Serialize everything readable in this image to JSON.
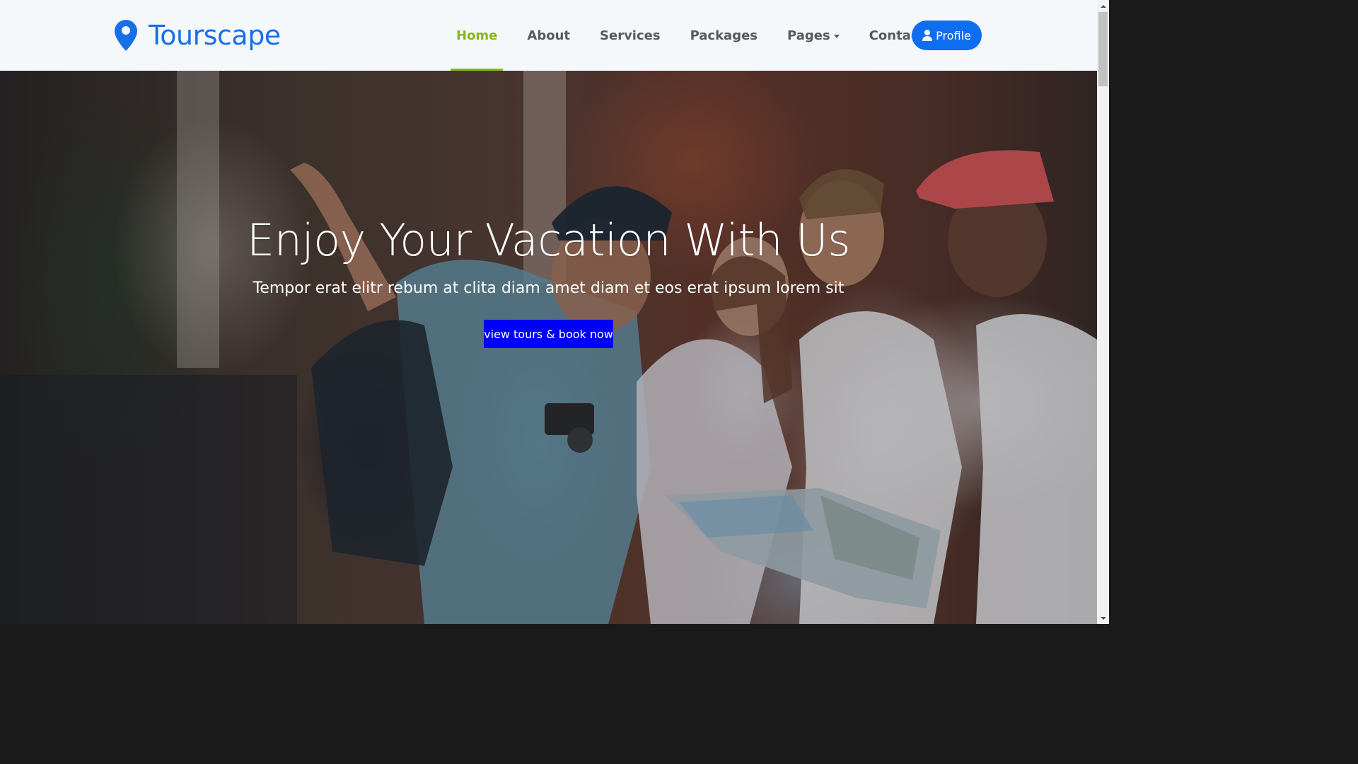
{
  "brand": {
    "name": "Tourscape",
    "icon": "map-marker-icon",
    "color": "#1870e8"
  },
  "nav": {
    "items": [
      {
        "label": "Home",
        "active": true
      },
      {
        "label": "About"
      },
      {
        "label": "Services"
      },
      {
        "label": "Packages"
      },
      {
        "label": "Pages",
        "dropdown": true
      },
      {
        "label": "Contact"
      }
    ],
    "active_color": "#86b817",
    "profile_label": "Profile",
    "profile_icon": "user-icon",
    "profile_color": "#0f6ef0"
  },
  "hero": {
    "title": "Enjoy Your Vacation With Us",
    "subtitle": "Tempor erat elitr rebum at clita diam amet diam et eos erat ipsum lorem sit",
    "cta_label": "view tours & book now",
    "cta_color": "#0000ff",
    "background_image": "group-of-travelers-reading-map-photo"
  }
}
